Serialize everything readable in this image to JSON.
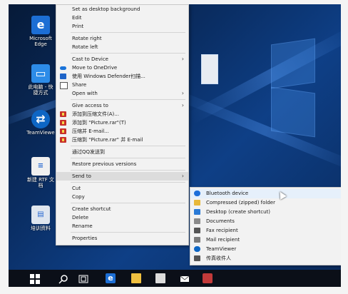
{
  "desktop": {
    "icons": [
      {
        "label": "Microsoft Edge",
        "line1": "Microsoft",
        "line2": "Edge"
      },
      {
        "label": "此电脑 - 快捷方式",
        "line1": "此电脑 - 快",
        "line2": "捷方式"
      },
      {
        "label": "TeamViewer",
        "line1": "TeamViewe",
        "line2": ""
      },
      {
        "label": "新建 RTF 文档",
        "line1": "新建 RTF 文",
        "line2": "档"
      },
      {
        "label": "培训资料",
        "line1": "培训资料",
        "line2": ""
      }
    ]
  },
  "context_menu": {
    "items": [
      {
        "type": "item",
        "label": "Set as desktop background"
      },
      {
        "type": "item",
        "label": "Edit"
      },
      {
        "type": "item",
        "label": "Print"
      },
      {
        "type": "sep"
      },
      {
        "type": "item",
        "label": "Rotate right"
      },
      {
        "type": "item",
        "label": "Rotate left"
      },
      {
        "type": "sep"
      },
      {
        "type": "item",
        "label": "Cast to Device",
        "arrow": true
      },
      {
        "type": "item",
        "label": "Move to OneDrive",
        "icon": "onedrive-icon"
      },
      {
        "type": "item",
        "label": "使用 Windows Defender扫描...",
        "icon": "windows-defender-icon"
      },
      {
        "type": "item",
        "label": "Share",
        "icon": "share-icon"
      },
      {
        "type": "item",
        "label": "Open with",
        "arrow": true
      },
      {
        "type": "sep"
      },
      {
        "type": "item",
        "label": "Give access to",
        "arrow": true
      },
      {
        "type": "item",
        "label": "添加到压缩文件(A)...",
        "icon": "winrar-icon"
      },
      {
        "type": "item",
        "label": "添加到 \"Picture.rar\"(T)",
        "icon": "winrar-icon"
      },
      {
        "type": "item",
        "label": "压缩并 E-mail...",
        "icon": "winrar-icon"
      },
      {
        "type": "item",
        "label": "压缩到 \"Picture.rar\" 并 E-mail",
        "icon": "winrar-icon"
      },
      {
        "type": "sep"
      },
      {
        "type": "item",
        "label": "通过QQ发送到"
      },
      {
        "type": "sep"
      },
      {
        "type": "item",
        "label": "Restore previous versions"
      },
      {
        "type": "sep"
      },
      {
        "type": "item",
        "label": "Send to",
        "arrow": true,
        "highlight": true
      },
      {
        "type": "sep"
      },
      {
        "type": "item",
        "label": "Cut"
      },
      {
        "type": "item",
        "label": "Copy"
      },
      {
        "type": "sep"
      },
      {
        "type": "item",
        "label": "Create shortcut"
      },
      {
        "type": "item",
        "label": "Delete"
      },
      {
        "type": "item",
        "label": "Rename"
      },
      {
        "type": "sep"
      },
      {
        "type": "item",
        "label": "Properties"
      }
    ]
  },
  "send_to_menu": {
    "items": [
      {
        "label": "Bluetooth device",
        "icon": "bluetooth-icon",
        "color": "#1e6fd9",
        "highlight": true
      },
      {
        "label": "Compressed (zipped) folder",
        "icon": "zip-folder-icon",
        "color": "#e8b83a"
      },
      {
        "label": "Desktop (create shortcut)",
        "icon": "desktop-icon",
        "color": "#2a7ad6"
      },
      {
        "label": "Documents",
        "icon": "documents-icon",
        "color": "#8a8a8a"
      },
      {
        "label": "Fax recipient",
        "icon": "fax-icon",
        "color": "#555555"
      },
      {
        "label": "Mail recipient",
        "icon": "mail-icon",
        "color": "#7a7a7a"
      },
      {
        "label": "TeamViewer",
        "icon": "teamviewer-icon",
        "color": "#0e66c4"
      },
      {
        "label": "传真收件人",
        "icon": "fax-icon",
        "color": "#555555"
      }
    ]
  },
  "taskbar": {
    "icons": [
      "windows-start-icon",
      "search-icon",
      "task-view-icon",
      "edge-icon",
      "file-explorer-icon",
      "store-icon",
      "mail-icon",
      "app-icon"
    ]
  }
}
